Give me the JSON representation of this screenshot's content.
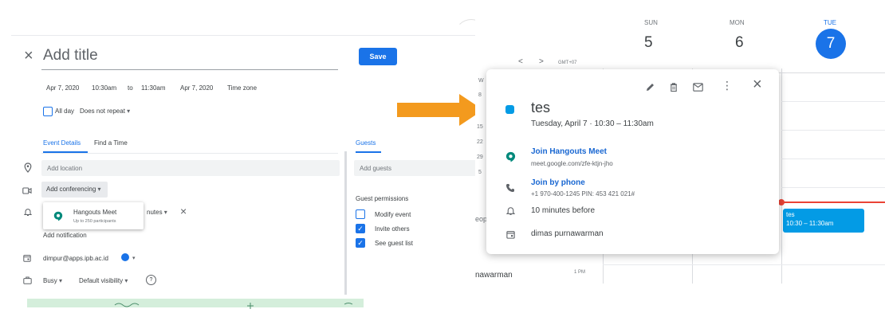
{
  "editor": {
    "close_glyph": "×",
    "title_placeholder": "Add title",
    "save_label": "Save",
    "start_date": "Apr 7, 2020",
    "start_time": "10:30am",
    "to_label": "to",
    "end_time": "11:30am",
    "end_date": "Apr 7, 2020",
    "timezone_label": "Time zone",
    "allday_label": "All day",
    "repeat_label": "Does not repeat",
    "tabs": {
      "details": "Event Details",
      "find": "Find a Time"
    },
    "location_placeholder": "Add location",
    "conferencing_label": "Add conferencing",
    "conf_option": {
      "title": "Hangouts Meet",
      "subtitle": "Up to 250 participants"
    },
    "notification_unit": "nutes",
    "remove_glyph": "×",
    "add_notification": "Add notification",
    "calendar_owner": "dimpur@apps.ipb.ac.id",
    "busy_label": "Busy",
    "visibility_label": "Default visibility",
    "help_glyph": "?"
  },
  "guests": {
    "tab_label": "Guests",
    "add_placeholder": "Add guests",
    "permissions_title": "Guest permissions",
    "permissions": [
      {
        "label": "Modify event",
        "checked": false
      },
      {
        "label": "Invite others",
        "checked": true
      },
      {
        "label": "See guest list",
        "checked": true
      }
    ]
  },
  "calendar": {
    "days": [
      {
        "name": "SUN",
        "num": "5"
      },
      {
        "name": "MON",
        "num": "6"
      },
      {
        "name": "TUE",
        "num": "7"
      }
    ],
    "prev_glyph": "<",
    "next_glyph": ">",
    "gmt_label": "GMT+07",
    "left_partial": [
      "W",
      "8",
      "15",
      "22",
      "29",
      "5"
    ],
    "side_fragment": "eop",
    "bottom_name": "nawarman",
    "time_1pm": "1 PM",
    "event_chip": {
      "title": "tes",
      "time": "10:30 – 11:30am"
    }
  },
  "popup": {
    "title": "tes",
    "datetime": "Tuesday, April 7  ·  10:30 – 11:30am",
    "join_meet_label": "Join Hangouts Meet",
    "meet_url": "meet.google.com/zfe-ktjn-jho",
    "join_phone_label": "Join by phone",
    "phone_detail": "+1 970-400-1245 PIN: 453 421 021#",
    "reminder": "10 minutes before",
    "organizer": "dimas purnawarman",
    "more_glyph": "⋮",
    "close_glyph": "×"
  },
  "colors": {
    "accent": "#1a73e8",
    "event": "#039be5",
    "arrow": "#f39a1e",
    "meet_green": "#00897b"
  }
}
